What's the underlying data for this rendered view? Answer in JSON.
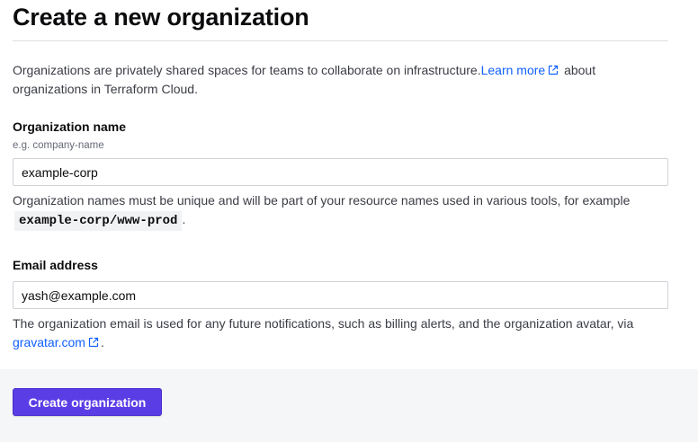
{
  "page": {
    "title": "Create a new organization"
  },
  "intro": {
    "text": "Organizations are privately shared spaces for teams to collaborate on infrastructure.",
    "link_label": "Learn more",
    "text_after_link": " about organizations in Terraform Cloud."
  },
  "org_name": {
    "label": "Organization name",
    "hint": "e.g. company-name",
    "value": "example-corp",
    "help_text": "Organization names must be unique and will be part of your resource names used in various tools, for example ",
    "example_code": "example-corp/www-prod",
    "help_suffix": "."
  },
  "email": {
    "label": "Email address",
    "value": "yash@example.com",
    "help_text": "The organization email is used for any future notifications, such as billing alerts, and the organization avatar, via ",
    "link_label": "gravatar.com",
    "help_suffix": "."
  },
  "footer": {
    "submit_label": "Create organization"
  },
  "colors": {
    "primary": "#5b3de6",
    "link": "#1060ff",
    "footer_bg": "#f5f6f7"
  }
}
